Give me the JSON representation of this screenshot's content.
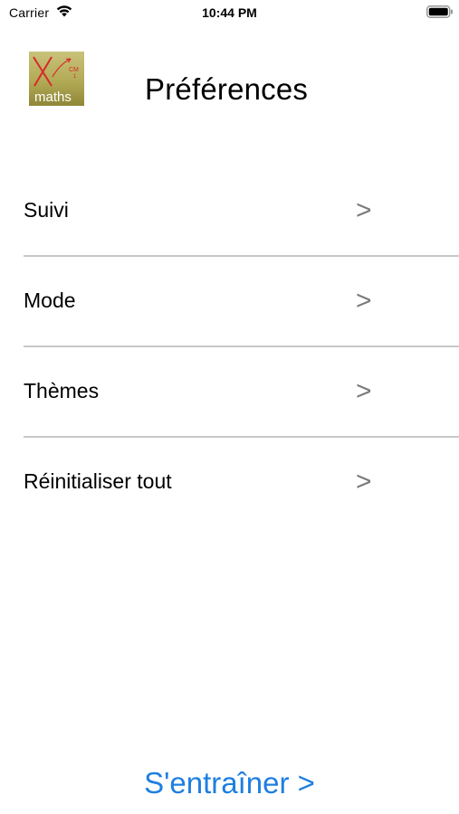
{
  "status_bar": {
    "carrier": "Carrier",
    "time": "10:44 PM",
    "wifi_icon": "wifi-icon",
    "battery_icon": "battery-icon"
  },
  "header": {
    "logo": {
      "text": "maths",
      "superscript": "CM",
      "subscript": "1",
      "icon": "app-logo"
    },
    "title": "Préférences"
  },
  "menu": {
    "items": [
      {
        "label": "Suivi",
        "chevron": ">"
      },
      {
        "label": "Mode",
        "chevron": ">"
      },
      {
        "label": "Thèmes",
        "chevron": ">"
      },
      {
        "label": "Réinitialiser tout",
        "chevron": ">"
      }
    ]
  },
  "footer": {
    "train_label": "S'entraîner >"
  },
  "colors": {
    "accent": "#1e7fe0",
    "separator": "#c8c8c8",
    "chevron": "#7a7a7a",
    "logo_bg": "#b4ad5a"
  }
}
